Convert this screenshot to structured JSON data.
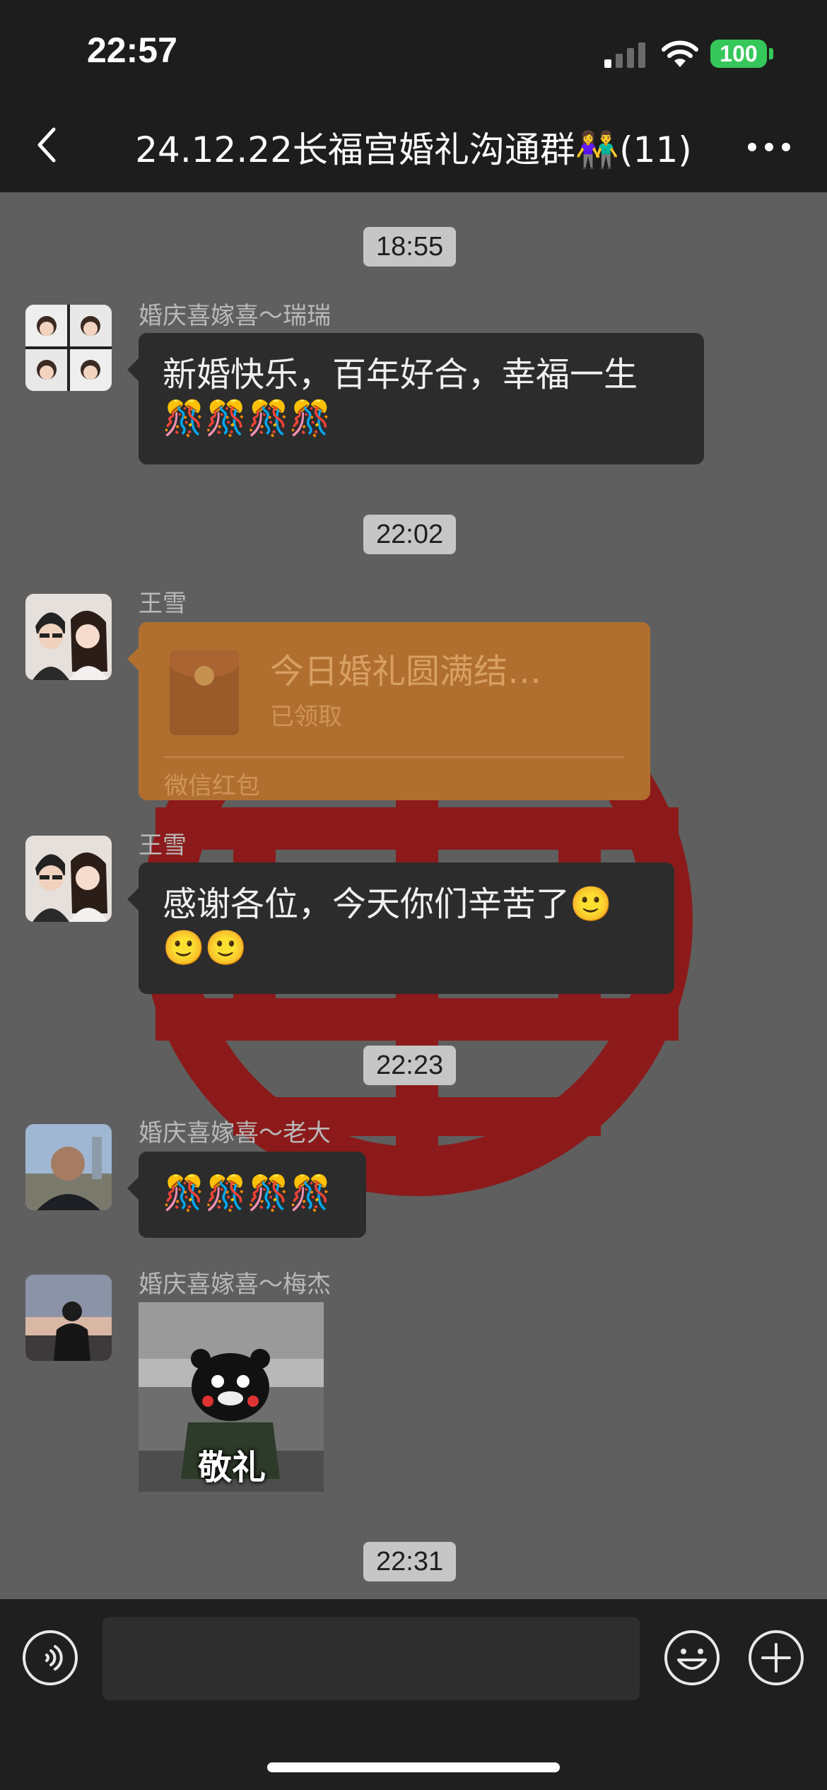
{
  "status_bar": {
    "time": "22:57",
    "battery": "100"
  },
  "header": {
    "title": "24.12.22长福宫婚礼沟通群👫(11)"
  },
  "messages": [
    {
      "type": "time",
      "text": "18:55"
    },
    {
      "type": "text",
      "sender": "婚庆喜嫁喜～瑞瑞",
      "line1": "新婚快乐，百年好合，幸福一生",
      "line2": "🎊🎊🎊🎊"
    },
    {
      "type": "time",
      "text": "22:02"
    },
    {
      "type": "red_packet",
      "sender": "王雪",
      "title": "今日婚礼圆满结…",
      "status": "已领取",
      "footer": "微信红包"
    },
    {
      "type": "text",
      "sender": "王雪",
      "line1": "感谢各位，今天你们辛苦了🙂",
      "line2": "🙂🙂"
    },
    {
      "type": "time",
      "text": "22:23"
    },
    {
      "type": "text",
      "sender": "婚庆喜嫁喜～老大",
      "line1": "🎊🎊🎊🎊"
    },
    {
      "type": "sticker",
      "sender": "婚庆喜嫁喜～梅杰",
      "caption": "敬礼"
    },
    {
      "type": "time",
      "text": "22:31"
    }
  ],
  "input_bar": {
    "voice_icon": "voice-icon",
    "emoji_icon": "emoji-icon",
    "plus_icon": "plus-icon"
  },
  "colors": {
    "background": "#1d1d1d",
    "chat_bg": "#5f5f5f",
    "bubble": "#2c2c2c",
    "red_packet": "#b06f2f",
    "battery": "#35c759"
  }
}
